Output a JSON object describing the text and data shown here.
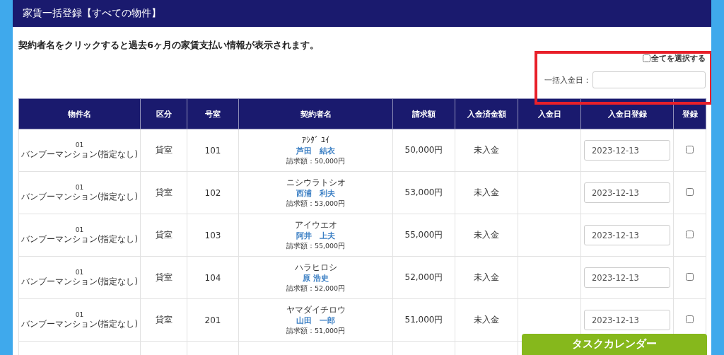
{
  "header": {
    "title": "家賃一括登録【すべての物件】"
  },
  "instruction": "契約者名をクリックすると過去6ヶ月の家賃支払い情報が表示されます。",
  "select_all": {
    "label": "全てを選択する",
    "checked": false
  },
  "bulk_date": {
    "label": "一括入金日："
  },
  "table": {
    "columns": [
      "物件名",
      "区分",
      "号室",
      "契約者名",
      "請求額",
      "入金済金額",
      "入金日",
      "入金日登録",
      "登録"
    ],
    "rows": [
      {
        "property_code": "01",
        "property_name": "バンブーマンション(指定なし)",
        "type": "貸室",
        "room": "101",
        "kana": "ｱｼﾀﾞ ﾕｲ",
        "name": "芦田　結衣",
        "billing": "請求額：50,000円",
        "amount": "50,000円",
        "paid": "未入金",
        "register_date": "2023-12-13",
        "checked": false
      },
      {
        "property_code": "01",
        "property_name": "バンブーマンション(指定なし)",
        "type": "貸室",
        "room": "102",
        "kana": "ニシウラトシオ",
        "name": "西浦　利夫",
        "billing": "請求額：53,000円",
        "amount": "53,000円",
        "paid": "未入金",
        "register_date": "2023-12-13",
        "checked": false
      },
      {
        "property_code": "01",
        "property_name": "バンブーマンション(指定なし)",
        "type": "貸室",
        "room": "103",
        "kana": "アイウエオ",
        "name": "阿井　上夫",
        "billing": "請求額：55,000円",
        "amount": "55,000円",
        "paid": "未入金",
        "register_date": "2023-12-13",
        "checked": false
      },
      {
        "property_code": "01",
        "property_name": "バンブーマンション(指定なし)",
        "type": "貸室",
        "room": "104",
        "kana": "ハラヒロシ",
        "name": "原 浩史",
        "billing": "請求額：52,000円",
        "amount": "52,000円",
        "paid": "未入金",
        "register_date": "2023-12-13",
        "checked": false
      },
      {
        "property_code": "01",
        "property_name": "バンブーマンション(指定なし)",
        "type": "貸室",
        "room": "201",
        "kana": "ヤマダイチロウ",
        "name": "山田　一郎",
        "billing": "請求額：51,000円",
        "amount": "51,000円",
        "paid": "未入金",
        "register_date": "2023-12-13",
        "checked": false
      }
    ]
  },
  "calendar_button": {
    "label": "タスクカレンダー"
  }
}
